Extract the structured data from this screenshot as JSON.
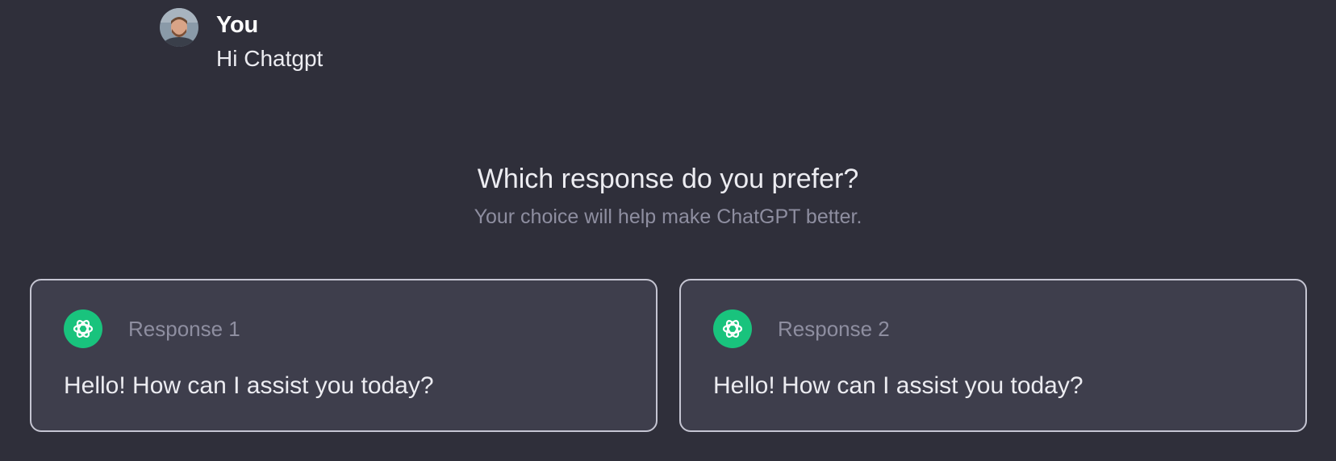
{
  "user": {
    "name": "You",
    "message": "Hi Chatgpt"
  },
  "prompt": {
    "title": "Which response do you prefer?",
    "subtitle": "Your choice will help make ChatGPT better."
  },
  "responses": [
    {
      "label": "Response 1",
      "text": "Hello! How can I assist you today?"
    },
    {
      "label": "Response 2",
      "text": "Hello! How can I assist you today?"
    }
  ],
  "colors": {
    "background": "#2f2f3a",
    "card_background": "#3e3e4c",
    "card_border": "#c5c5d2",
    "bot_icon": "#19c37d",
    "muted_text": "#8e8ea0"
  },
  "icons": {
    "user_avatar": "user-avatar-photo",
    "bot": "openai-logo-icon"
  }
}
